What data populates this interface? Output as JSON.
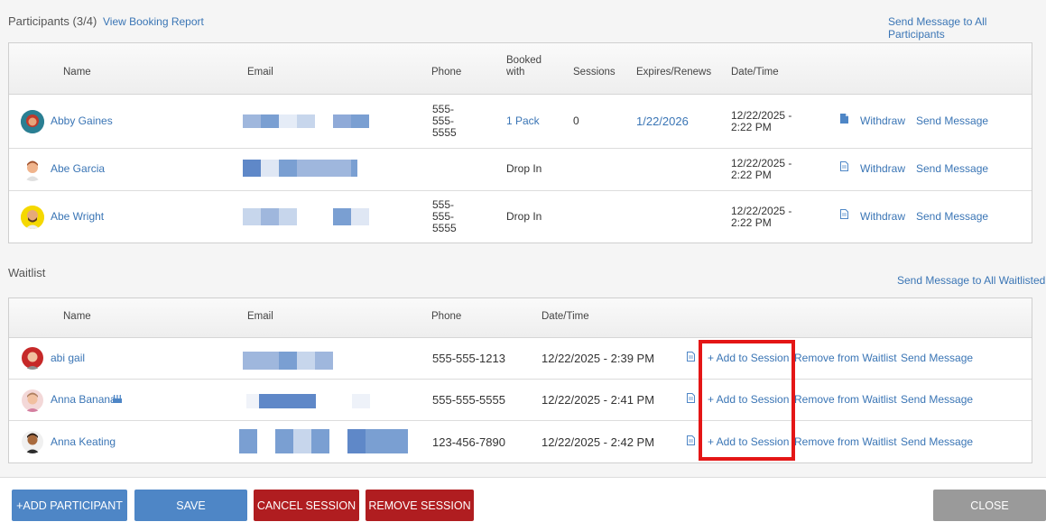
{
  "participants": {
    "title": "Participants",
    "count": "(3/4)",
    "view_report": "View Booking Report",
    "send_all": "Send Message to All Participants",
    "headers": {
      "name": "Name",
      "email": "Email",
      "phone": "Phone",
      "booked_with": "Booked with",
      "sessions": "Sessions",
      "expires": "Expires/Renews",
      "datetime": "Date/Time"
    },
    "rows": [
      {
        "name": "Abby Gaines",
        "phone": "555-\n555-\n5555",
        "booked_with": "1 Pack",
        "sessions": "0",
        "expires": "1/22/2026",
        "datetime": "12/22/2025 -\n2:22 PM",
        "withdraw": "Withdraw",
        "send": "Send Message"
      },
      {
        "name": "Abe Garcia",
        "phone": "",
        "booked_with": "Drop In",
        "sessions": "",
        "expires": "",
        "datetime": "12/22/2025 -\n2:22 PM",
        "withdraw": "Withdraw",
        "send": "Send Message"
      },
      {
        "name": "Abe Wright",
        "phone": "555-\n555-\n5555",
        "booked_with": "Drop In",
        "sessions": "",
        "expires": "",
        "datetime": "12/22/2025 -\n2:22 PM",
        "withdraw": "Withdraw",
        "send": "Send Message"
      }
    ]
  },
  "waitlist": {
    "title": "Waitlist",
    "send_all": "Send Message to All Waitlisted",
    "headers": {
      "name": "Name",
      "email": "Email",
      "phone": "Phone",
      "datetime": "Date/Time"
    },
    "rows": [
      {
        "name": "abi gail",
        "phone": "555-555-1213",
        "datetime": "12/22/2025 - 2:39 PM",
        "add": "+ Add to Session",
        "remove": "Remove from Waitlist",
        "send": "Send Message"
      },
      {
        "name": "Anna Banana",
        "phone": "555-555-5555",
        "datetime": "12/22/2025 - 2:41 PM",
        "add": "+ Add to Session",
        "remove": "Remove from Waitlist",
        "send": "Send Message"
      },
      {
        "name": "Anna Keating",
        "phone": "123-456-7890",
        "datetime": "12/22/2025 - 2:42 PM",
        "add": "+ Add to Session",
        "remove": "Remove from Waitlist",
        "send": "Send Message"
      }
    ]
  },
  "footer": {
    "add_participant": "+ADD PARTICIPANT",
    "save": "SAVE",
    "cancel_session": "CANCEL SESSION",
    "remove_session": "REMOVE SESSION",
    "close": "CLOSE"
  },
  "icons": [
    "doc-icon",
    "birthday-cake-icon",
    "avatar"
  ],
  "colors": {
    "link": "#3a75b5",
    "blue_button": "#4e86c6",
    "red_button": "#b01d20",
    "gray_button": "#9a9a9a",
    "highlight": "#e41616"
  }
}
